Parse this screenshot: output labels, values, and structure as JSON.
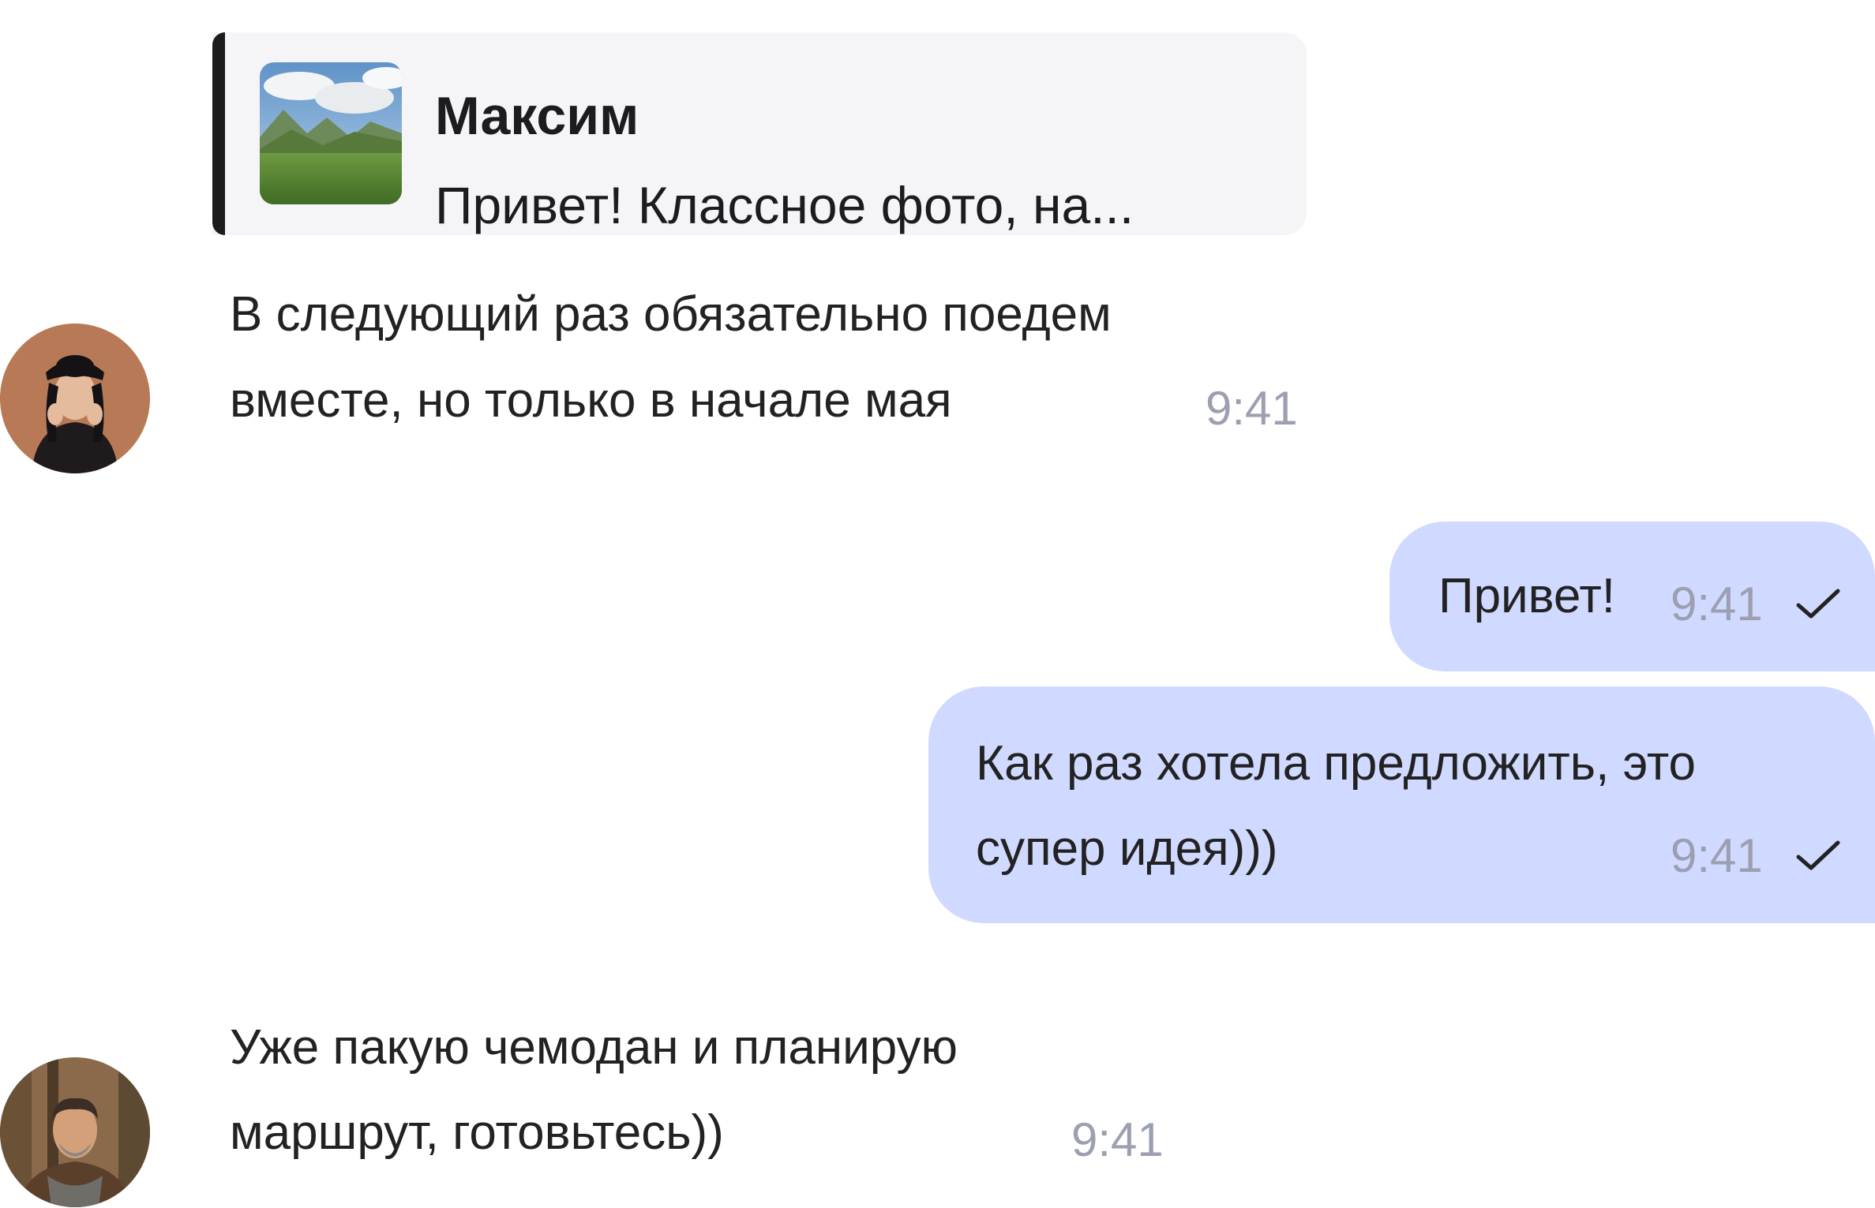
{
  "reply": {
    "author": "Максим",
    "snippet": "Привет! Классное фото, на..."
  },
  "messages": [
    {
      "direction": "incoming",
      "avatar": "woman-in-black-hat-avatar",
      "lines": [
        "В следующий раз обязательно поедем",
        "вместе, но только в начале мая"
      ],
      "time": "9:41"
    },
    {
      "direction": "outgoing",
      "lines": [
        "Привет!"
      ],
      "time": "9:41",
      "status": "sent-check-icon"
    },
    {
      "direction": "outgoing",
      "lines": [
        "Как раз хотела предложить, это",
        "супер идея)))"
      ],
      "time": "9:41",
      "status": "sent-check-icon"
    },
    {
      "direction": "incoming",
      "avatar": "man-with-scarf-avatar",
      "lines": [
        "Уже пакую чемодан и планирую",
        "маршрут, готовьтесь))"
      ],
      "time": "9:41"
    }
  ],
  "colors": {
    "outgoing_bubble": "#d0d9ff",
    "reply_background": "#f5f5f7",
    "reply_accent": "#1c1c1e",
    "timestamp": "#9b9fb0",
    "text": "#222222"
  }
}
